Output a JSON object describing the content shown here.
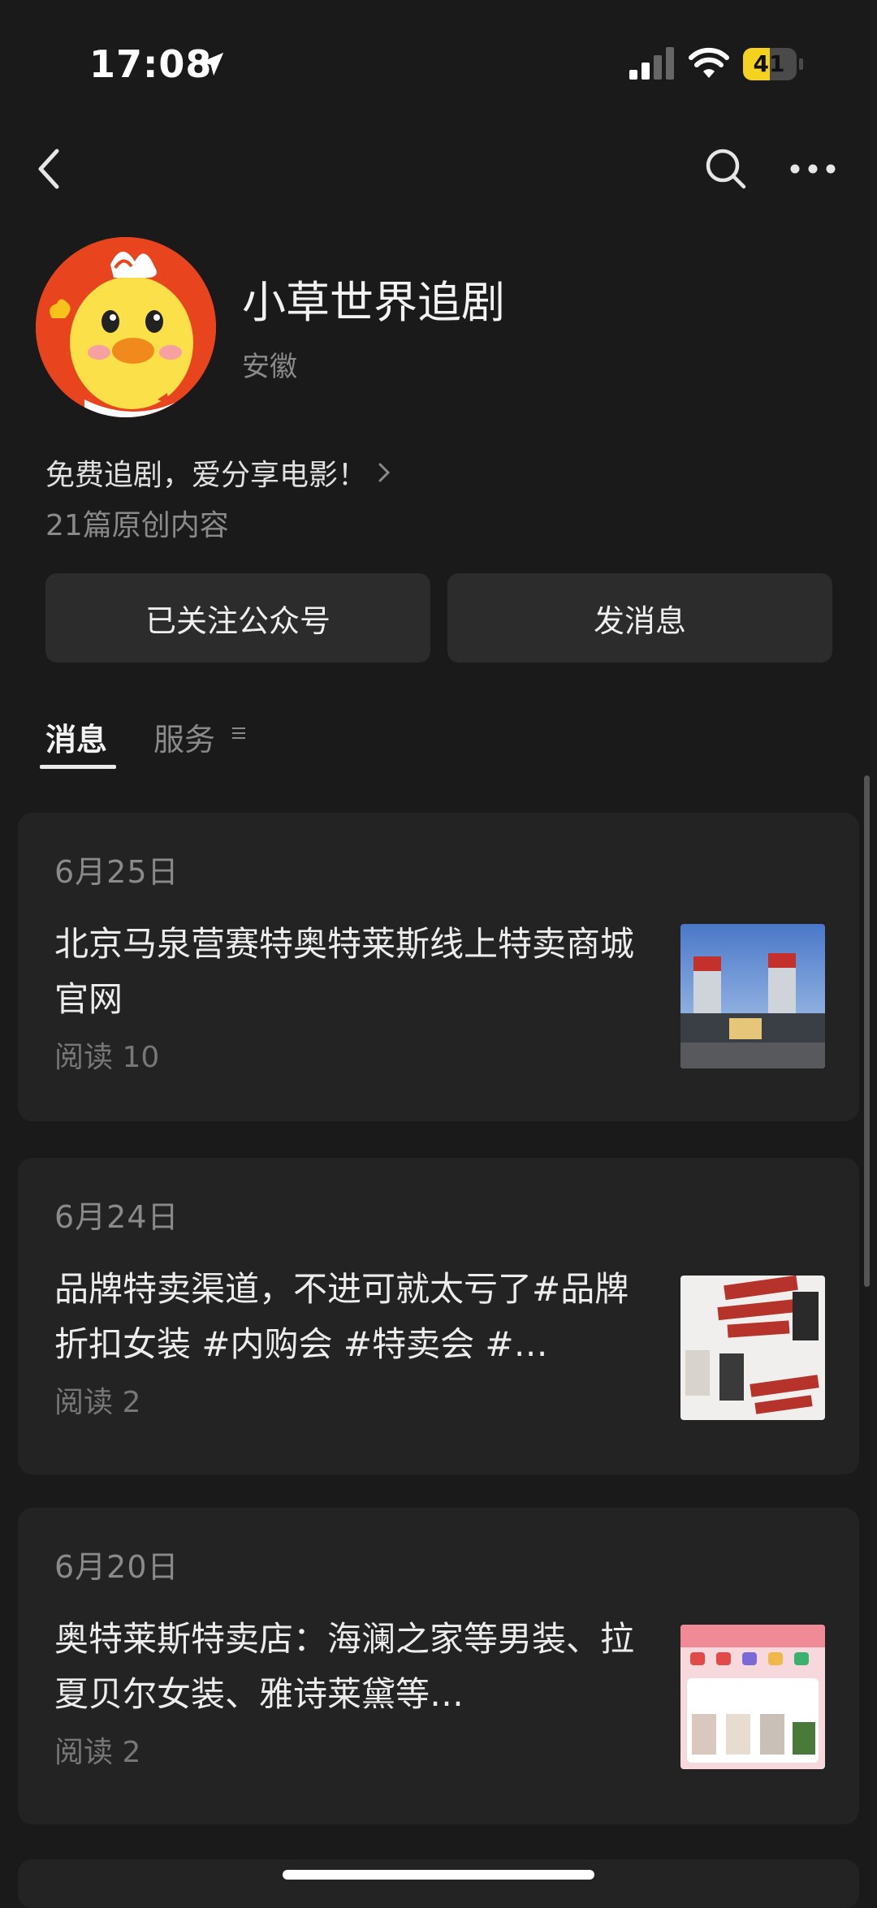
{
  "status_bar": {
    "time": "17:08",
    "battery": "41"
  },
  "nav": {
    "back": "back",
    "search": "search",
    "more": "more"
  },
  "account": {
    "name": "小草世界追剧",
    "region": "安徽",
    "description": "免费追剧，爱分享电影！",
    "article_count": "21篇原创内容",
    "follow_button": "已关注公众号",
    "message_button": "发消息"
  },
  "tabs": [
    {
      "label": "消息",
      "active": true
    },
    {
      "label": "服务",
      "active": false
    }
  ],
  "messages": [
    {
      "date": "6月25日",
      "title": "北京马泉营赛特奥特莱斯线上特卖商城官网",
      "reads": "阅读 10"
    },
    {
      "date": "6月24日",
      "title": "品牌特卖渠道，不进可就太亏了#品牌折扣女装 #内购会 #特卖会 #…",
      "reads": "阅读 2"
    },
    {
      "date": "6月20日",
      "title": "奥特莱斯特卖店：海澜之家等男装、拉夏贝尔女装、雅诗莱黛等…",
      "reads": "阅读 2"
    }
  ],
  "icons": {
    "back": "chevron-left-icon",
    "search": "search-icon",
    "more": "more-dots-icon",
    "location": "location-arrow-icon",
    "signal": "signal-icon",
    "wifi": "wifi-icon",
    "battery": "battery-icon",
    "description_chevron": "chevron-right-icon",
    "service_menu": "menu-icon"
  },
  "colors": {
    "background": "#1a1a1a",
    "card": "#232323",
    "button": "#2c2c2c",
    "battery": "#f5d21f",
    "avatar_bg": "#e8451f"
  }
}
